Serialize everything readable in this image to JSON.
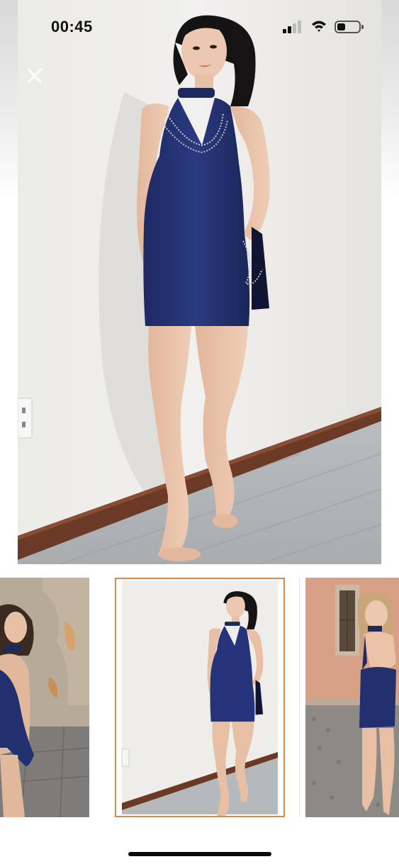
{
  "status_bar": {
    "time": "00:45",
    "signal_icon": "cellular-signal-icon",
    "wifi_icon": "wifi-icon",
    "battery_icon": "battery-low-icon"
  },
  "viewer": {
    "close_icon": "close-icon",
    "main_image": "model-in-navy-halter-mini-dress-leaning-on-wall",
    "accent_color": "#d58b44"
  },
  "thumbnails": [
    {
      "image": "model-navy-dress-side-view-ruined-wall",
      "selected": false
    },
    {
      "image": "model-navy-halter-mini-dress-leaning-on-wall",
      "selected": true
    },
    {
      "image": "model-navy-dress-back-view-street",
      "selected": false
    }
  ]
}
